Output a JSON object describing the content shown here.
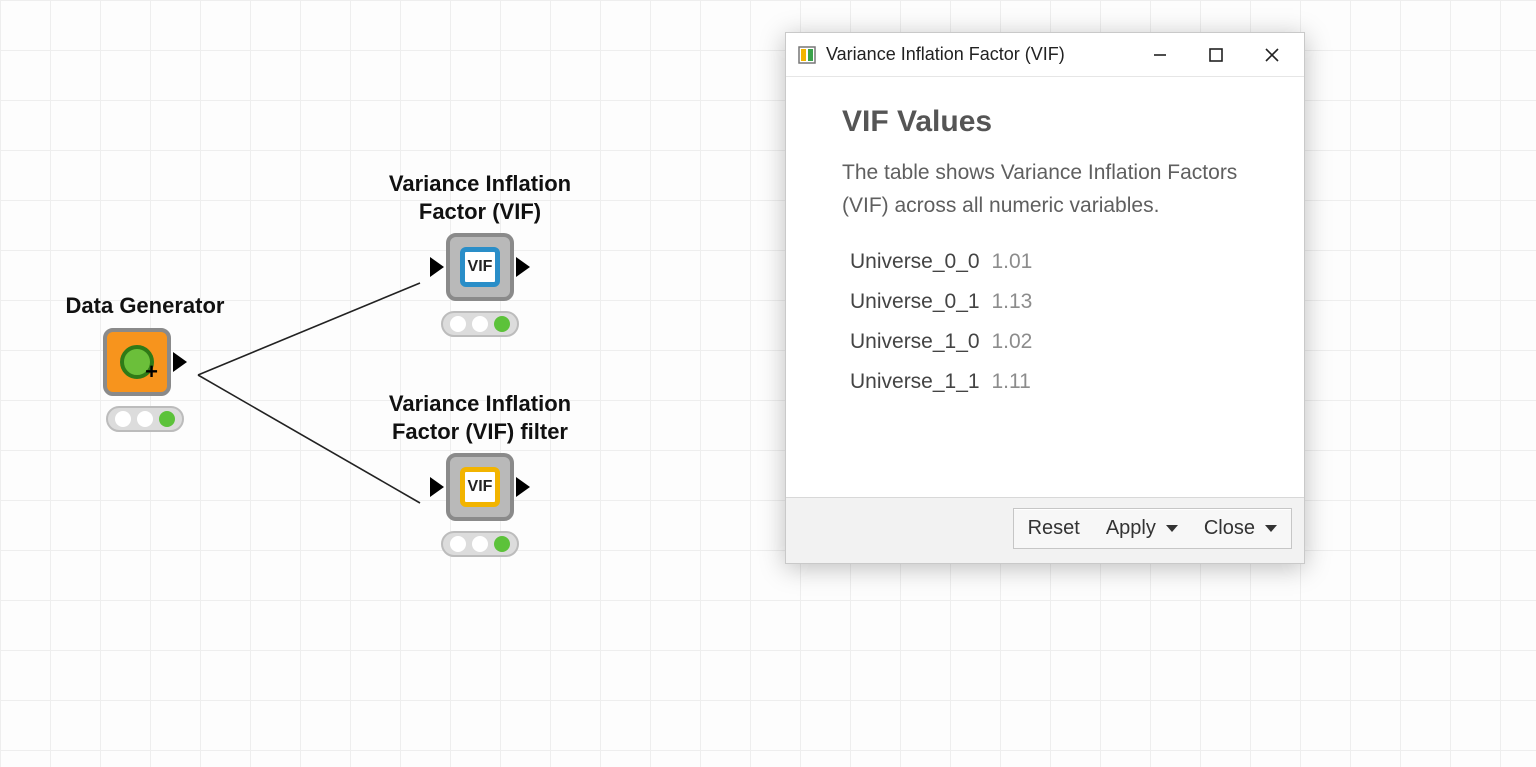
{
  "workflow": {
    "nodes": {
      "data_generator": {
        "label": "Data Generator",
        "icon_text": ""
      },
      "vif": {
        "label": "Variance Inflation\nFactor (VIF)",
        "icon_text": "VIF"
      },
      "vif_filter": {
        "label": "Variance Inflation\nFactor (VIF) filter",
        "icon_text": "VIF"
      }
    }
  },
  "dialog": {
    "title": "Variance Inflation Factor (VIF)",
    "heading": "VIF Values",
    "description": "The table shows Variance Inflation Factors (VIF) across all numeric variables.",
    "rows": [
      {
        "name": "Universe_0_0",
        "value": "1.01"
      },
      {
        "name": "Universe_0_1",
        "value": "1.13"
      },
      {
        "name": "Universe_1_0",
        "value": "1.02"
      },
      {
        "name": "Universe_1_1",
        "value": "1.11"
      }
    ],
    "buttons": {
      "reset": "Reset",
      "apply": "Apply",
      "close": "Close"
    }
  }
}
